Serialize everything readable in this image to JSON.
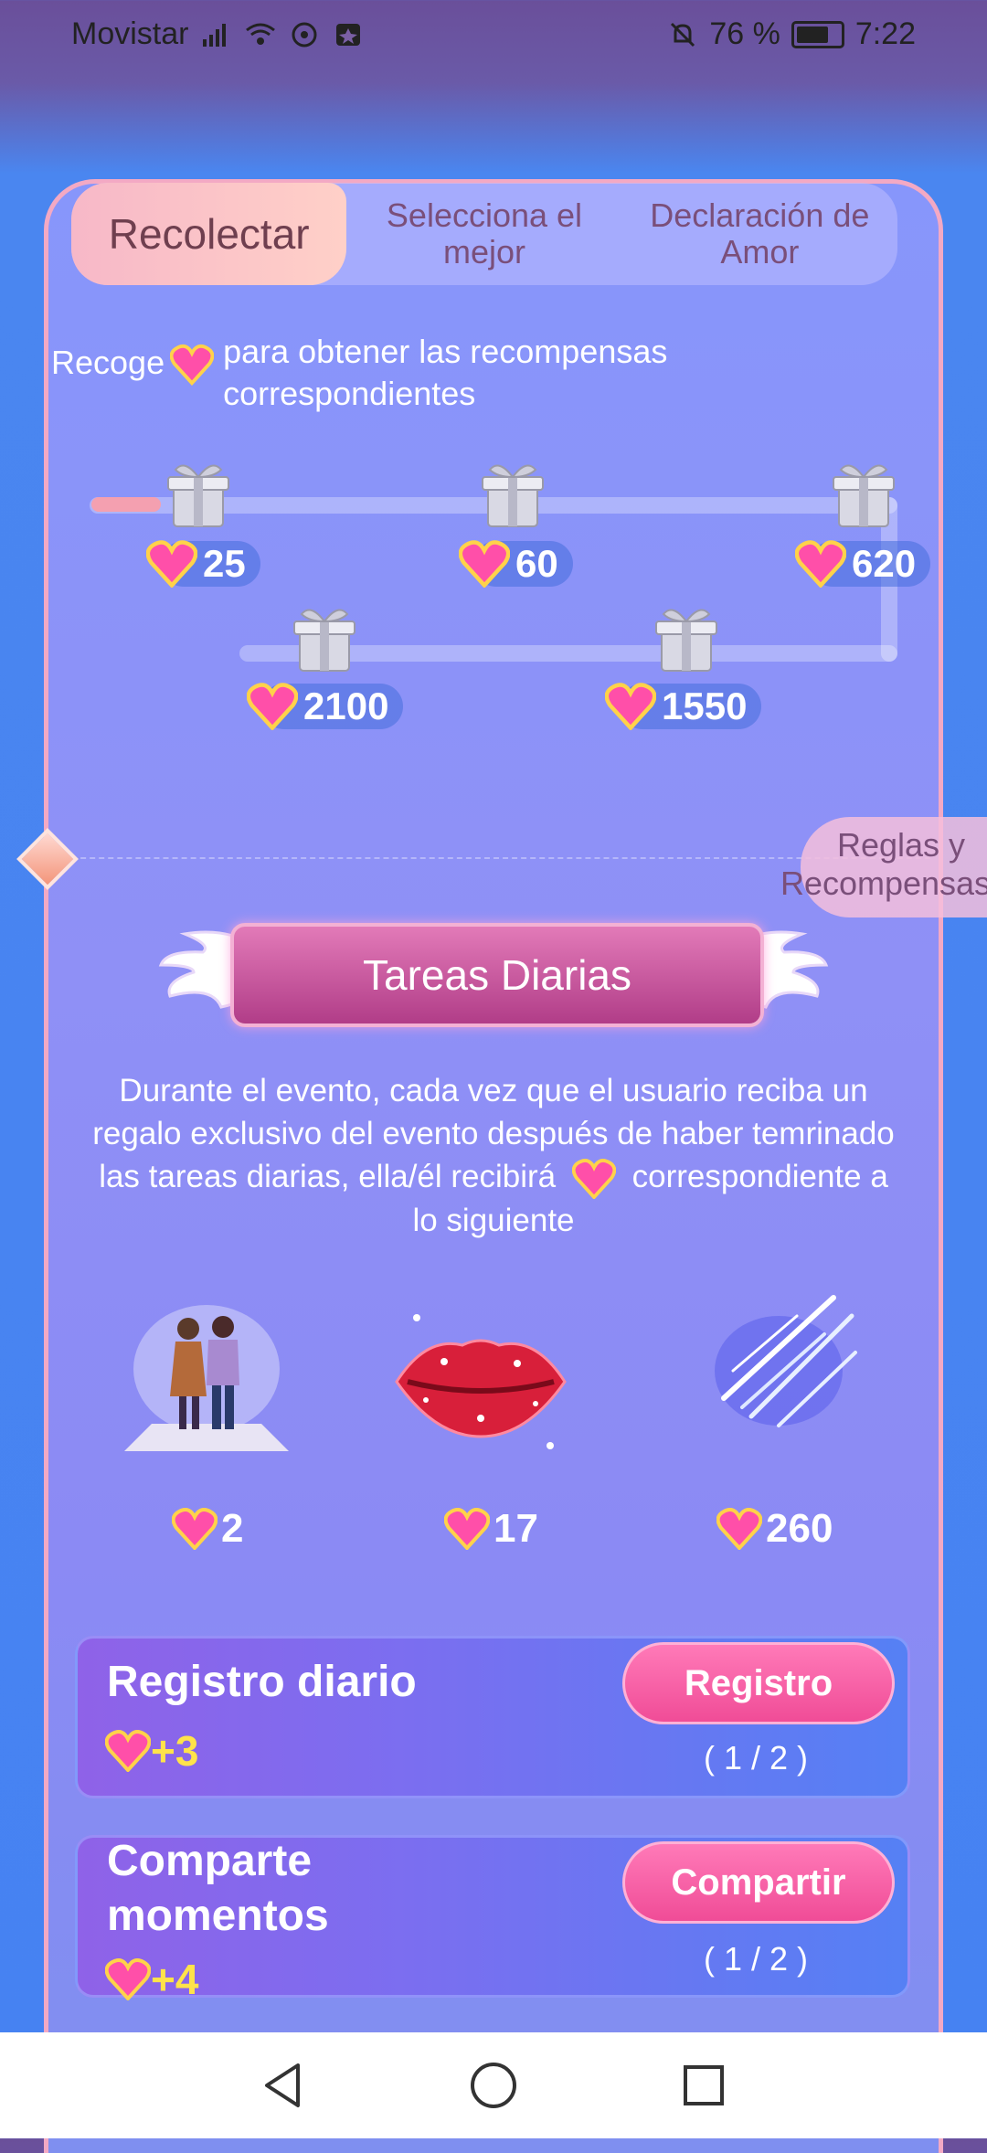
{
  "status": {
    "carrier": "Movistar",
    "battery": "76 %",
    "time": "7:22"
  },
  "tabs": [
    {
      "label": "Recolectar"
    },
    {
      "label": "Selecciona el mejor"
    },
    {
      "label": "Declaración de Amor"
    }
  ],
  "collect": {
    "before": "Recoge",
    "after": "para obtener las recompensas correspondientes"
  },
  "milestones": [
    "25",
    "60",
    "620",
    "2100",
    "1550"
  ],
  "rules_button": {
    "line1": "Reglas y",
    "line2": "Recompensas"
  },
  "daily": {
    "title": "Tareas Diarias",
    "desc_part1": "Durante el evento, cada vez que el usuario reciba un regalo exclusivo del evento después de haber temrinado las tareas diarias, ella/él recibirá",
    "desc_part2": "correspondiente a lo siguiente"
  },
  "gifts": [
    {
      "icon": "couple-gift-icon",
      "value": "2"
    },
    {
      "icon": "lips-gift-icon",
      "value": "17"
    },
    {
      "icon": "meteor-shower-gift-icon",
      "value": "260"
    }
  ],
  "tasks": [
    {
      "title": "Registro diario",
      "reward": "+3",
      "button": "Registro",
      "count": "( 1 / 2 )"
    },
    {
      "title": "Comparte momentos",
      "reward": "+4",
      "button": "Compartir",
      "count": "( 1 / 2 )"
    }
  ],
  "colors": {
    "accent_pink": "#f04c97",
    "reward_yellow": "#ffe34a",
    "background_blue": "#4682f2"
  }
}
